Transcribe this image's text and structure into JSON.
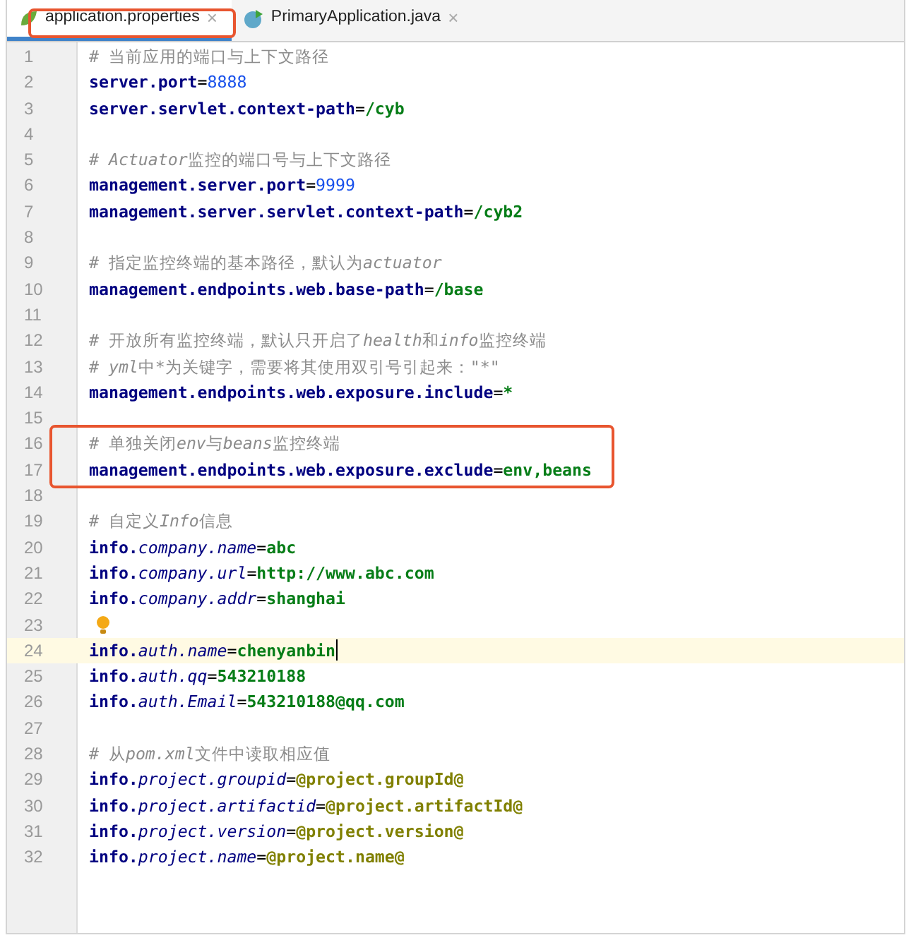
{
  "tabs": [
    {
      "label": "application.properties",
      "kind": "properties",
      "selected": true,
      "highlighted": true,
      "close": "×"
    },
    {
      "label": "PrimaryApplication.java",
      "kind": "java",
      "selected": false,
      "highlighted": false,
      "close": "×"
    }
  ],
  "lines": [
    {
      "n": "1",
      "segs": [
        {
          "kind": "comment",
          "t": "# 当前应用的端口与上下文路径"
        }
      ]
    },
    {
      "n": "2",
      "segs": [
        {
          "kind": "key",
          "t": "server.port"
        },
        {
          "kind": "eq",
          "t": "="
        },
        {
          "kind": "number",
          "t": "8888"
        }
      ]
    },
    {
      "n": "3",
      "segs": [
        {
          "kind": "key",
          "t": "server.servlet.context-path"
        },
        {
          "kind": "eq",
          "t": "="
        },
        {
          "kind": "value",
          "t": "/cyb"
        }
      ]
    },
    {
      "n": "4"
    },
    {
      "n": "5",
      "segs": [
        {
          "kind": "comment",
          "t": "# "
        },
        {
          "kind": "comment-italic",
          "t": "Actuator"
        },
        {
          "kind": "comment",
          "t": "监控的端口号与上下文路径"
        }
      ]
    },
    {
      "n": "6",
      "segs": [
        {
          "kind": "key",
          "t": "management.server.port"
        },
        {
          "kind": "eq",
          "t": "="
        },
        {
          "kind": "number",
          "t": "9999"
        }
      ]
    },
    {
      "n": "7",
      "segs": [
        {
          "kind": "key",
          "t": "management.server.servlet.context-path"
        },
        {
          "kind": "eq",
          "t": "="
        },
        {
          "kind": "value",
          "t": "/cyb2"
        }
      ]
    },
    {
      "n": "8"
    },
    {
      "n": "9",
      "segs": [
        {
          "kind": "comment",
          "t": "# 指定监控终端的基本路径，默认为"
        },
        {
          "kind": "comment-italic",
          "t": "actuator"
        }
      ]
    },
    {
      "n": "10",
      "segs": [
        {
          "kind": "key",
          "t": "management.endpoints.web.base-path"
        },
        {
          "kind": "eq",
          "t": "="
        },
        {
          "kind": "value",
          "t": "/base"
        }
      ]
    },
    {
      "n": "11"
    },
    {
      "n": "12",
      "segs": [
        {
          "kind": "comment",
          "t": "# 开放所有监控终端，默认只开启了"
        },
        {
          "kind": "comment-italic",
          "t": "health"
        },
        {
          "kind": "comment",
          "t": "和"
        },
        {
          "kind": "comment-italic",
          "t": "info"
        },
        {
          "kind": "comment",
          "t": "监控终端"
        }
      ]
    },
    {
      "n": "13",
      "segs": [
        {
          "kind": "comment",
          "t": "# "
        },
        {
          "kind": "comment-italic",
          "t": "yml"
        },
        {
          "kind": "comment",
          "t": "中*为关键字，需要将其使用双引号引起来：\"*\""
        }
      ]
    },
    {
      "n": "14",
      "segs": [
        {
          "kind": "key",
          "t": "management.endpoints.web.exposure.include"
        },
        {
          "kind": "eq",
          "t": "="
        },
        {
          "kind": "value",
          "t": "*"
        }
      ]
    },
    {
      "n": "15"
    },
    {
      "n": "16",
      "boxed": true,
      "segs": [
        {
          "kind": "comment",
          "t": "# 单独关闭"
        },
        {
          "kind": "comment-italic",
          "t": "env"
        },
        {
          "kind": "comment",
          "t": "与"
        },
        {
          "kind": "comment-italic",
          "t": "beans"
        },
        {
          "kind": "comment",
          "t": "监控终端"
        }
      ]
    },
    {
      "n": "17",
      "boxed": true,
      "segs": [
        {
          "kind": "key",
          "t": "management.endpoints.web.exposure.exclude"
        },
        {
          "kind": "eq",
          "t": "="
        },
        {
          "kind": "value",
          "t": "env,beans"
        }
      ]
    },
    {
      "n": "18"
    },
    {
      "n": "19",
      "segs": [
        {
          "kind": "comment",
          "t": "# 自定义"
        },
        {
          "kind": "comment-italic",
          "t": "Info"
        },
        {
          "kind": "comment",
          "t": "信息"
        }
      ]
    },
    {
      "n": "20",
      "segs": [
        {
          "kind": "key",
          "t": "info."
        },
        {
          "kind": "subkey",
          "t": "company.name"
        },
        {
          "kind": "eq",
          "t": "="
        },
        {
          "kind": "value",
          "t": "abc"
        }
      ]
    },
    {
      "n": "21",
      "segs": [
        {
          "kind": "key",
          "t": "info."
        },
        {
          "kind": "subkey",
          "t": "company.url"
        },
        {
          "kind": "eq",
          "t": "="
        },
        {
          "kind": "value",
          "t": "http://www.abc.com"
        }
      ]
    },
    {
      "n": "22",
      "segs": [
        {
          "kind": "key",
          "t": "info."
        },
        {
          "kind": "subkey",
          "t": "company.addr"
        },
        {
          "kind": "eq",
          "t": "="
        },
        {
          "kind": "value",
          "t": "shanghai"
        }
      ]
    },
    {
      "n": "23",
      "bulb": true
    },
    {
      "n": "24",
      "current": true,
      "segs": [
        {
          "kind": "key",
          "t": "info."
        },
        {
          "kind": "subkey",
          "t": "auth.name"
        },
        {
          "kind": "eq",
          "t": "="
        },
        {
          "kind": "value",
          "t": "chenyanbin"
        }
      ]
    },
    {
      "n": "25",
      "segs": [
        {
          "kind": "key",
          "t": "info."
        },
        {
          "kind": "subkey",
          "t": "auth.qq"
        },
        {
          "kind": "eq",
          "t": "="
        },
        {
          "kind": "value",
          "t": "543210188"
        }
      ]
    },
    {
      "n": "26",
      "segs": [
        {
          "kind": "key",
          "t": "info."
        },
        {
          "kind": "subkey",
          "t": "auth.Email"
        },
        {
          "kind": "eq",
          "t": "="
        },
        {
          "kind": "value",
          "t": "543210188@qq.com"
        }
      ]
    },
    {
      "n": "27"
    },
    {
      "n": "28",
      "segs": [
        {
          "kind": "comment",
          "t": "# 从"
        },
        {
          "kind": "comment-italic",
          "t": "pom.xml"
        },
        {
          "kind": "comment",
          "t": "文件中读取相应值"
        }
      ]
    },
    {
      "n": "29",
      "segs": [
        {
          "kind": "key",
          "t": "info."
        },
        {
          "kind": "subkey",
          "t": "project.groupid"
        },
        {
          "kind": "eq",
          "t": "="
        },
        {
          "kind": "ref",
          "t": "@project.groupId@"
        }
      ]
    },
    {
      "n": "30",
      "segs": [
        {
          "kind": "key",
          "t": "info."
        },
        {
          "kind": "subkey",
          "t": "project.artifactid"
        },
        {
          "kind": "eq",
          "t": "="
        },
        {
          "kind": "ref",
          "t": "@project.artifactId@"
        }
      ]
    },
    {
      "n": "31",
      "segs": [
        {
          "kind": "key",
          "t": "info."
        },
        {
          "kind": "subkey",
          "t": "project.version"
        },
        {
          "kind": "eq",
          "t": "="
        },
        {
          "kind": "ref",
          "t": "@project.version@"
        }
      ]
    },
    {
      "n": "32",
      "segs": [
        {
          "kind": "key",
          "t": "info."
        },
        {
          "kind": "subkey",
          "t": "project.name"
        },
        {
          "kind": "eq",
          "t": "="
        },
        {
          "kind": "ref",
          "t": "@project.name@"
        }
      ]
    }
  ]
}
